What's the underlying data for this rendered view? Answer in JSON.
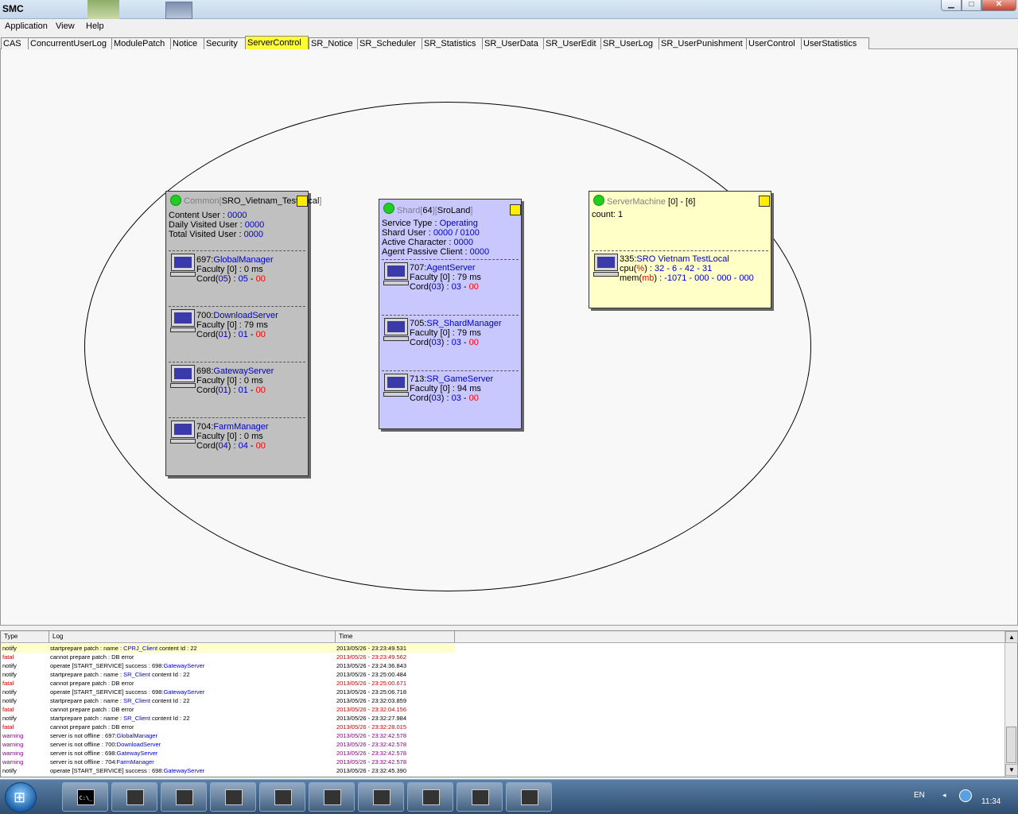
{
  "window": {
    "title": "SMC",
    "controls": {
      "minimize": "▁",
      "maximize": "□",
      "close": "✕"
    }
  },
  "menu": [
    "Application",
    "View",
    "Help"
  ],
  "tabs": [
    "CAS",
    "ConcurrentUserLog",
    "ModulePatch",
    "Notice",
    "Security",
    "ServerControl",
    "SR_Notice",
    "SR_Scheduler",
    "SR_Statistics",
    "SR_UserData",
    "SR_UserEdit",
    "SR_UserLog",
    "SR_UserPunishment",
    "UserControl",
    "UserStatistics"
  ],
  "active_tab": "ServerControl",
  "common": {
    "head_prefix": "Common[",
    "head_name": "SRO_Vietnam_TestLocal",
    "head_suffix": "]",
    "content_user_label": "Content User : ",
    "content_user": "0000",
    "daily_label": "Daily Visited User : ",
    "daily": "0000",
    "total_label": "Total Visited User : ",
    "total": "0000",
    "servers": [
      {
        "id": "697:",
        "name": "GlobalManager",
        "faculty": "Faculty [0] : 0 ms",
        "cord_prefix": "Cord(",
        "cord_a": "05",
        "cord_mid": ") : ",
        "cord_b": "05",
        "cord_dash": " - ",
        "cord_c": "00"
      },
      {
        "id": "700:",
        "name": "DownloadServer",
        "faculty": "Faculty [0] : 79 ms",
        "cord_prefix": "Cord(",
        "cord_a": "01",
        "cord_mid": ") : ",
        "cord_b": "01",
        "cord_dash": " - ",
        "cord_c": "00"
      },
      {
        "id": "698:",
        "name": "GatewayServer",
        "faculty": "Faculty [0] : 0 ms",
        "cord_prefix": "Cord(",
        "cord_a": "01",
        "cord_mid": ") : ",
        "cord_b": "01",
        "cord_dash": " - ",
        "cord_c": "00"
      },
      {
        "id": "704:",
        "name": "FarmManager",
        "faculty": "Faculty [0] : 0 ms",
        "cord_prefix": "Cord(",
        "cord_a": "04",
        "cord_mid": ") : ",
        "cord_b": "04",
        "cord_dash": " - ",
        "cord_c": "00"
      }
    ]
  },
  "shard": {
    "head_prefix": "Shard[",
    "head_id": "64",
    "head_mid": "][",
    "head_name": "SroLand",
    "head_suffix": "]",
    "service_label": "Service Type : ",
    "service": "Operating",
    "shard_user_label": "Shard User : ",
    "shard_user": "0000 / 0100",
    "active_label": "Active Character : ",
    "active": "0000",
    "agent_label": "Agent Passive Client : ",
    "agent": "0000",
    "servers": [
      {
        "id": "707:",
        "name": "AgentServer",
        "faculty": "Faculty [0] : 79 ms",
        "cord_prefix": "Cord(",
        "cord_a": "03",
        "cord_mid": ") : ",
        "cord_b": "03",
        "cord_dash": " - ",
        "cord_c": "00"
      },
      {
        "id": "705:",
        "name": "SR_ShardManager",
        "faculty": "Faculty [0] : 79 ms",
        "cord_prefix": "Cord(",
        "cord_a": "03",
        "cord_mid": ") : ",
        "cord_b": "03",
        "cord_dash": " - ",
        "cord_c": "00"
      },
      {
        "id": "713:",
        "name": "SR_GameServer",
        "faculty": "Faculty [0] : 94 ms",
        "cord_prefix": "Cord(",
        "cord_a": "03",
        "cord_mid": ") : ",
        "cord_b": "03",
        "cord_dash": " - ",
        "cord_c": "00"
      }
    ]
  },
  "machine": {
    "head_name": "ServerMachine",
    "head_range": "[0] - [6]",
    "count": "count: 1",
    "entry_id": "335:",
    "entry_name": "SRO Vietnam TestLocal",
    "cpu_label": "cpu(",
    "cpu_unit": "%",
    "cpu_label_end": ") : ",
    "cpu_values": "32 - 6 - 42 - 31",
    "mem_label": "mem(",
    "mem_unit": "mb",
    "mem_label_end": ") : ",
    "mem_values": "-1071 - 000 - 000 - 000"
  },
  "log": {
    "columns": [
      "Type",
      "Log",
      "Time"
    ],
    "rows": [
      {
        "type": "notify",
        "log_pre": "startprepare patch : name : ",
        "log_hl": "CPRJ_Client",
        "log_post": " content Id : 22",
        "time": "2013/05/26 - 23:23:49.531"
      },
      {
        "type": "fatal",
        "log_pre": "cannot prepare patch : DB error",
        "log_hl": "",
        "log_post": "",
        "time": "2013/05/26 - 23:23:49.562"
      },
      {
        "type": "notify",
        "log_pre": "operate [START_SERVICE] success : 698:",
        "log_hl": "GatewayServer",
        "log_post": "",
        "time": "2013/05/26 - 23:24:36.843"
      },
      {
        "type": "notify",
        "log_pre": "startprepare patch : name : ",
        "log_hl": "SR_Client",
        "log_post": " content Id : 22",
        "time": "2013/05/26 - 23:25:00.484"
      },
      {
        "type": "fatal",
        "log_pre": "cannot prepare patch : DB error",
        "log_hl": "",
        "log_post": "",
        "time": "2013/05/26 - 23:25:00.671"
      },
      {
        "type": "notify",
        "log_pre": "operate [START_SERVICE] success : 698:",
        "log_hl": "GatewayServer",
        "log_post": "",
        "time": "2013/05/26 - 23:25:06.718"
      },
      {
        "type": "notify",
        "log_pre": "startprepare patch : name : ",
        "log_hl": "SR_Client",
        "log_post": " content Id : 22",
        "time": "2013/05/26 - 23:32:03.859"
      },
      {
        "type": "fatal",
        "log_pre": "cannot prepare patch : DB error",
        "log_hl": "",
        "log_post": "",
        "time": "2013/05/26 - 23:32:04.156"
      },
      {
        "type": "notify",
        "log_pre": "startprepare patch : name : ",
        "log_hl": "SR_Client",
        "log_post": " content Id : 22",
        "time": "2013/05/26 - 23:32:27.984"
      },
      {
        "type": "fatal",
        "log_pre": "cannot prepare patch : DB error",
        "log_hl": "",
        "log_post": "",
        "time": "2013/05/26 - 23:32:28.015"
      },
      {
        "type": "warning",
        "log_pre": "server is not offline : 697:",
        "log_hl": "GlobalManager",
        "log_post": "",
        "time": "2013/05/26 - 23:32:42.578"
      },
      {
        "type": "warning",
        "log_pre": "server is not offline : 700:",
        "log_hl": "DownloadServer",
        "log_post": "",
        "time": "2013/05/26 - 23:32:42.578"
      },
      {
        "type": "warning",
        "log_pre": "server is not offline : 698:",
        "log_hl": "GatewayServer",
        "log_post": "",
        "time": "2013/05/26 - 23:32:42.578"
      },
      {
        "type": "warning",
        "log_pre": "server is not offline : 704:",
        "log_hl": "FarmManager",
        "log_post": "",
        "time": "2013/05/26 - 23:32:42.578"
      },
      {
        "type": "notify",
        "log_pre": "operate [START_SERVICE] success : 698:",
        "log_hl": "GatewayServer",
        "log_post": "",
        "time": "2013/05/26 - 23:32:45.390"
      }
    ],
    "selected_row": 0,
    "scroll_up": "▲",
    "scroll_down": "▼"
  },
  "taskbar": {
    "start_glyph": "⊞",
    "cmd_label": "C:\\_",
    "window_count": 9,
    "lang": "EN",
    "tray_arrow": "◂",
    "clock": "11:34"
  },
  "colors": {
    "active_tab": "#ffff33",
    "common_bg": "#c0c0c0",
    "shard_bg": "#c8c8ff",
    "machine_bg": "#ffffc8",
    "status_ok": "#22cc22",
    "link_blue": "#0000cc",
    "error_red": "#ff0000"
  }
}
